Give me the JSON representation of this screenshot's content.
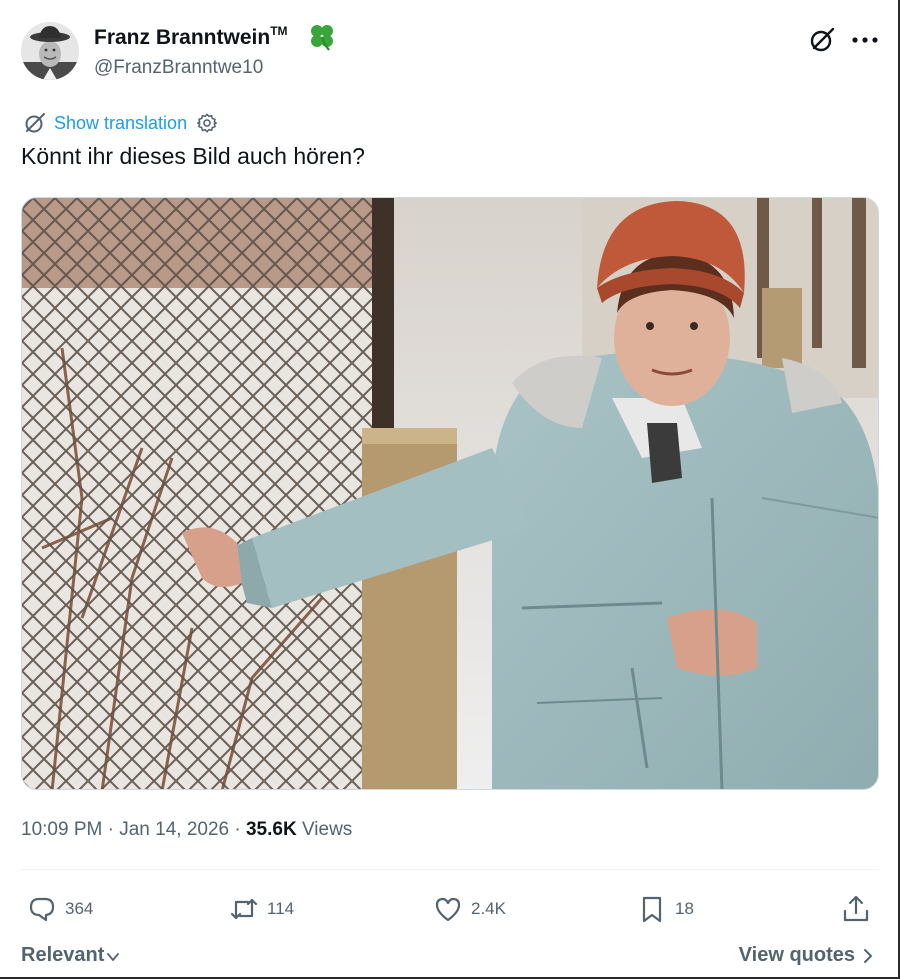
{
  "author": {
    "name": "Franz Branntwein",
    "trademark": "TM",
    "handle": "@FranzBranntwe10",
    "badge_icon": "four-leaf-clover-icon",
    "badge_color": "#3aa639"
  },
  "header_actions": {
    "grok_icon": "grok-icon",
    "more_icon": "more-horizontal-icon"
  },
  "translation": {
    "label": "Show translation",
    "color": "#1d9bf0"
  },
  "tweet": {
    "text": "Könnt ihr dieses Bild auch hören?"
  },
  "media": {
    "type": "photo"
  },
  "meta": {
    "time": "10:09 PM",
    "separator": " · ",
    "date": "Jan 14, 2026",
    "views_count": "35.6K",
    "views_label": "Views"
  },
  "actions": {
    "replies": "364",
    "reposts": "114",
    "likes": "2.4K",
    "bookmarks": "18"
  },
  "footer": {
    "sort_label": "Relevant",
    "quotes_label": "View quotes"
  }
}
